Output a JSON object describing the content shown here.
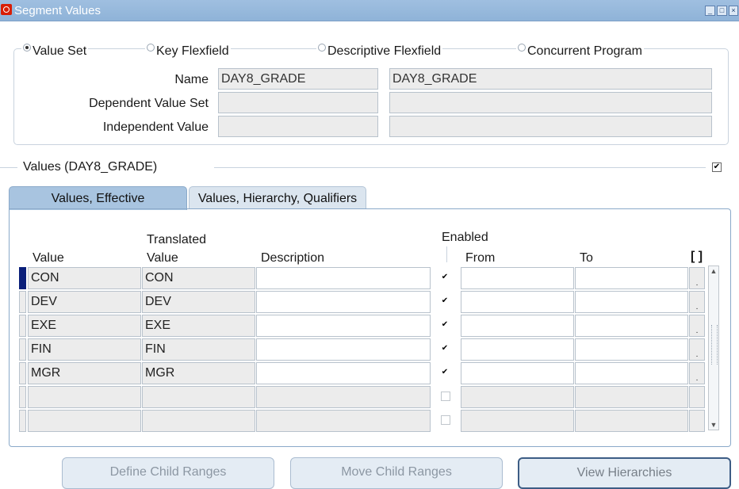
{
  "window": {
    "title": "Segment Values"
  },
  "source_types": [
    {
      "label": "Value Set",
      "selected": true
    },
    {
      "label": "Key Flexfield",
      "selected": false
    },
    {
      "label": "Descriptive Flexfield",
      "selected": false
    },
    {
      "label": "Concurrent Program",
      "selected": false
    }
  ],
  "header_fields": {
    "name_label": "Name",
    "name_value": "DAY8_GRADE",
    "name_desc": "DAY8_GRADE",
    "dependent_label": "Dependent Value Set",
    "dependent_value": "",
    "dependent_desc": "",
    "independent_label": "Independent Value",
    "independent_value": "",
    "independent_desc": ""
  },
  "values_section": {
    "title": "Values (DAY8_GRADE)",
    "checked": true
  },
  "tabs": [
    {
      "label": "Values, Effective",
      "active": true
    },
    {
      "label": "Values, Hierarchy, Qualifiers",
      "active": false
    }
  ],
  "columns": {
    "value": "Value",
    "translated_top": "Translated",
    "translated_bottom": "Value",
    "description": "Description",
    "enabled": "Enabled",
    "from": "From",
    "to": "To",
    "more": "[ ]"
  },
  "rows": [
    {
      "value": "CON",
      "translated": "CON",
      "description": "",
      "enabled": true,
      "from": "",
      "to": ""
    },
    {
      "value": "DEV",
      "translated": "DEV",
      "description": "",
      "enabled": true,
      "from": "",
      "to": ""
    },
    {
      "value": "EXE",
      "translated": "EXE",
      "description": "",
      "enabled": true,
      "from": "",
      "to": ""
    },
    {
      "value": "FIN",
      "translated": "FIN",
      "description": "",
      "enabled": true,
      "from": "",
      "to": ""
    },
    {
      "value": "MGR",
      "translated": "MGR",
      "description": "",
      "enabled": true,
      "from": "",
      "to": ""
    },
    {
      "value": "",
      "translated": "",
      "description": "",
      "enabled": false,
      "from": "",
      "to": ""
    },
    {
      "value": "",
      "translated": "",
      "description": "",
      "enabled": false,
      "from": "",
      "to": ""
    }
  ],
  "buttons": {
    "define_child_ranges": "Define Child Ranges",
    "move_child_ranges": "Move Child Ranges",
    "view_hierarchies": "View Hierarchies"
  },
  "icons": {
    "app": "oracle-icon",
    "minimize": "minimize-icon",
    "maximize": "maximize-icon",
    "close": "close-icon"
  },
  "colors": {
    "titlebar": "#8fb3d8",
    "active_tab": "#a8c4e0",
    "current_row": "#0a1f7a"
  }
}
